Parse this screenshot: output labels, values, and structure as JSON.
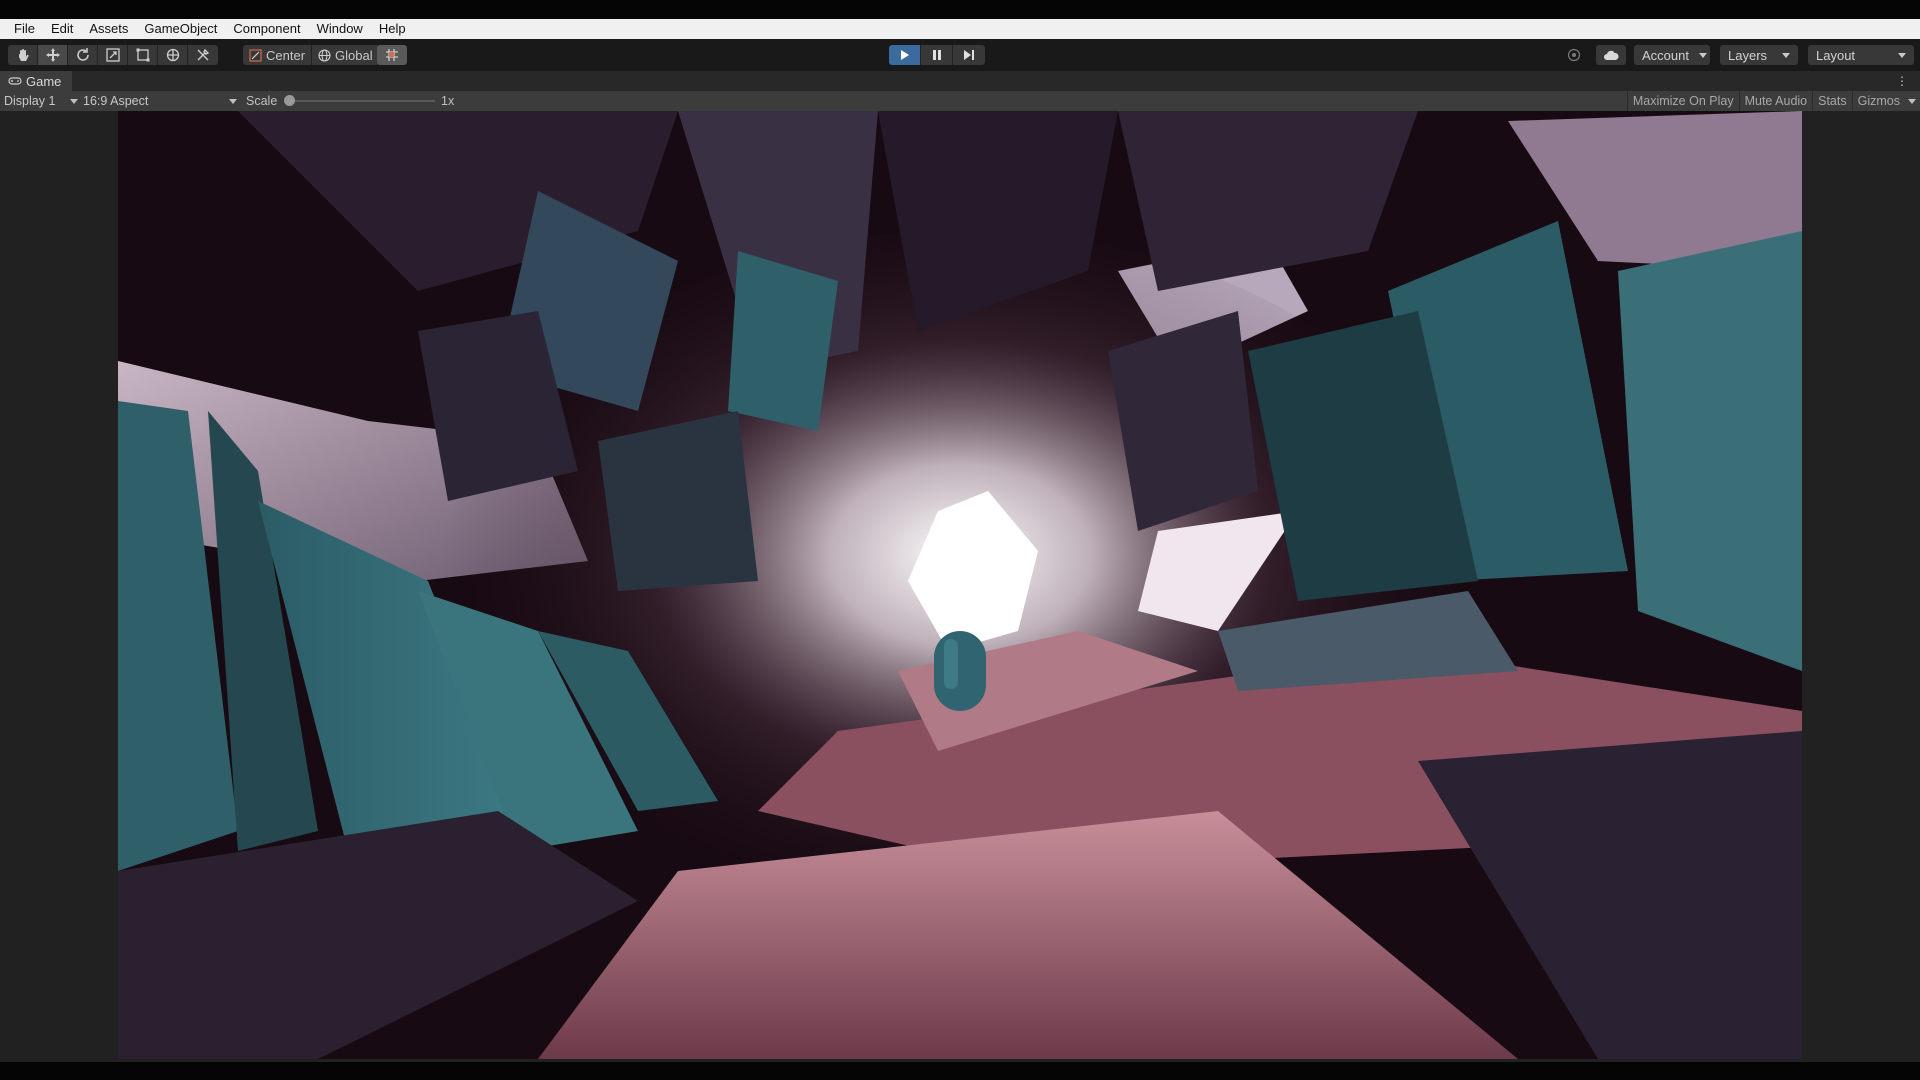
{
  "menubar": {
    "items": [
      "File",
      "Edit",
      "Assets",
      "GameObject",
      "Component",
      "Window",
      "Help"
    ]
  },
  "toolbar": {
    "tools": [
      "hand-tool-icon",
      "move-tool-icon",
      "rotate-tool-icon",
      "scale-tool-icon",
      "rect-tool-icon",
      "transform-tool-icon",
      "custom-tool-icon"
    ],
    "pivot_label": "Center",
    "space_label": "Global",
    "account_label": "Account",
    "layers_label": "Layers",
    "layout_label": "Layout",
    "accent_color": "#3b6b9e"
  },
  "game_tab": {
    "label": "Game"
  },
  "game_bar": {
    "display_label": "Display 1",
    "aspect_label": "16:9 Aspect",
    "scale_label": "Scale",
    "scale_value": "1x",
    "scale_level": 0.0,
    "maximize_label": "Maximize On Play",
    "mute_label": "Mute Audio",
    "stats_label": "Stats",
    "gizmos_label": "Gizmos"
  },
  "game_view": {
    "description_colors": [
      "#2f5a62",
      "#8a5060",
      "#1e1020",
      "#f4eef2"
    ]
  }
}
